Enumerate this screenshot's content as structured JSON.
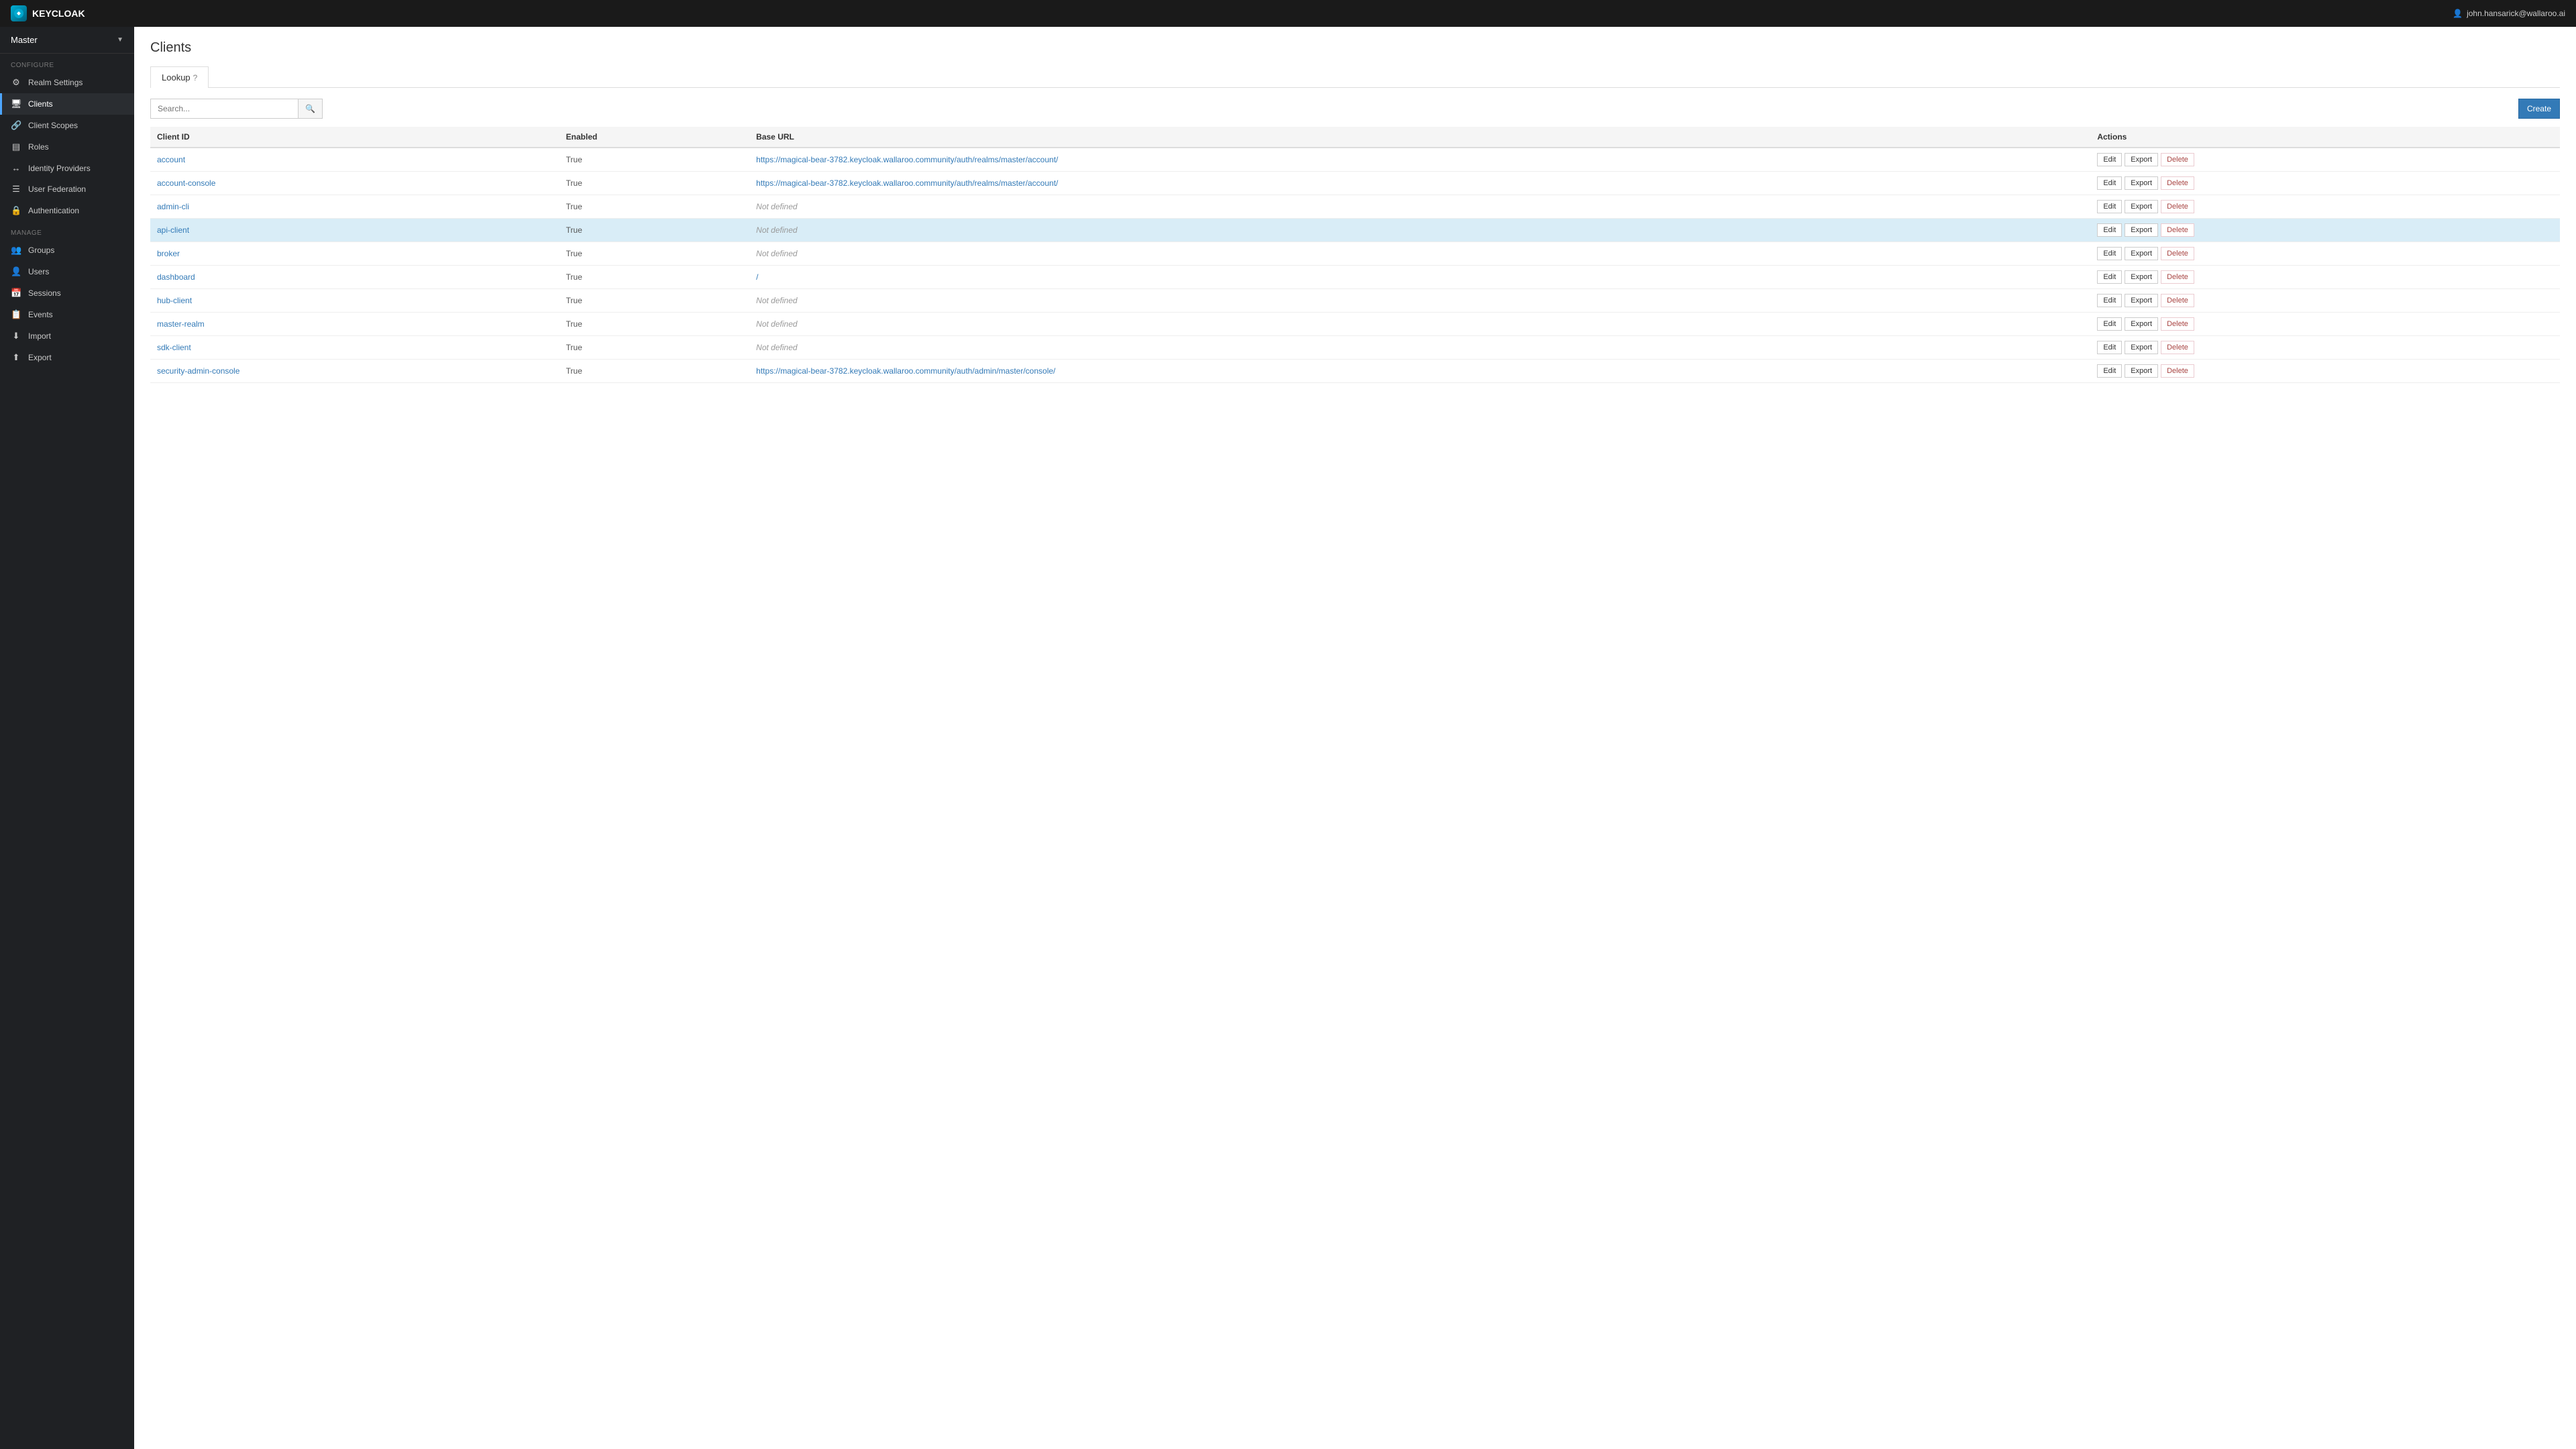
{
  "navbar": {
    "brand": "KEYCLOAK",
    "user": "john.hansarick@wallaroo.ai"
  },
  "realm": {
    "name": "Master"
  },
  "sidebar": {
    "configure_label": "Configure",
    "manage_label": "Manage",
    "configure_items": [
      {
        "id": "realm-settings",
        "label": "Realm Settings",
        "icon": "⚙"
      },
      {
        "id": "clients",
        "label": "Clients",
        "icon": "🖥",
        "active": true
      },
      {
        "id": "client-scopes",
        "label": "Client Scopes",
        "icon": "🔗"
      },
      {
        "id": "roles",
        "label": "Roles",
        "icon": "▤"
      },
      {
        "id": "identity-providers",
        "label": "Identity Providers",
        "icon": "↔"
      },
      {
        "id": "user-federation",
        "label": "User Federation",
        "icon": "☰"
      },
      {
        "id": "authentication",
        "label": "Authentication",
        "icon": "🔒"
      }
    ],
    "manage_items": [
      {
        "id": "groups",
        "label": "Groups",
        "icon": "👥"
      },
      {
        "id": "users",
        "label": "Users",
        "icon": "👤"
      },
      {
        "id": "sessions",
        "label": "Sessions",
        "icon": "📅"
      },
      {
        "id": "events",
        "label": "Events",
        "icon": "📋"
      },
      {
        "id": "import",
        "label": "Import",
        "icon": "⬇"
      },
      {
        "id": "export",
        "label": "Export",
        "icon": "⬆"
      }
    ]
  },
  "page": {
    "title": "Clients",
    "tab_lookup": "Lookup",
    "tab_help_icon": "?",
    "search_placeholder": "Search...",
    "search_btn_label": "🔍",
    "create_btn_label": "Create"
  },
  "table": {
    "columns": [
      {
        "id": "client-id",
        "label": "Client ID"
      },
      {
        "id": "enabled",
        "label": "Enabled"
      },
      {
        "id": "base-url",
        "label": "Base URL"
      },
      {
        "id": "actions",
        "label": "Actions"
      }
    ],
    "rows": [
      {
        "client_id": "account",
        "enabled": "True",
        "base_url": "https://magical-bear-3782.keycloak.wallaroo.community/auth/realms/master/account/",
        "base_url_type": "link",
        "highlighted": false
      },
      {
        "client_id": "account-console",
        "enabled": "True",
        "base_url": "https://magical-bear-3782.keycloak.wallaroo.community/auth/realms/master/account/",
        "base_url_type": "link",
        "highlighted": false
      },
      {
        "client_id": "admin-cli",
        "enabled": "True",
        "base_url": "Not defined",
        "base_url_type": "text",
        "highlighted": false
      },
      {
        "client_id": "api-client",
        "enabled": "True",
        "base_url": "Not defined",
        "base_url_type": "text",
        "highlighted": true
      },
      {
        "client_id": "broker",
        "enabled": "True",
        "base_url": "Not defined",
        "base_url_type": "text",
        "highlighted": false
      },
      {
        "client_id": "dashboard",
        "enabled": "True",
        "base_url": "/",
        "base_url_type": "link",
        "highlighted": false
      },
      {
        "client_id": "hub-client",
        "enabled": "True",
        "base_url": "Not defined",
        "base_url_type": "text",
        "highlighted": false
      },
      {
        "client_id": "master-realm",
        "enabled": "True",
        "base_url": "Not defined",
        "base_url_type": "text",
        "highlighted": false
      },
      {
        "client_id": "sdk-client",
        "enabled": "True",
        "base_url": "Not defined",
        "base_url_type": "text",
        "highlighted": false
      },
      {
        "client_id": "security-admin-console",
        "enabled": "True",
        "base_url": "https://magical-bear-3782.keycloak.wallaroo.community/auth/admin/master/console/",
        "base_url_type": "link",
        "highlighted": false
      }
    ],
    "action_edit": "Edit",
    "action_export": "Export",
    "action_delete": "Delete"
  }
}
